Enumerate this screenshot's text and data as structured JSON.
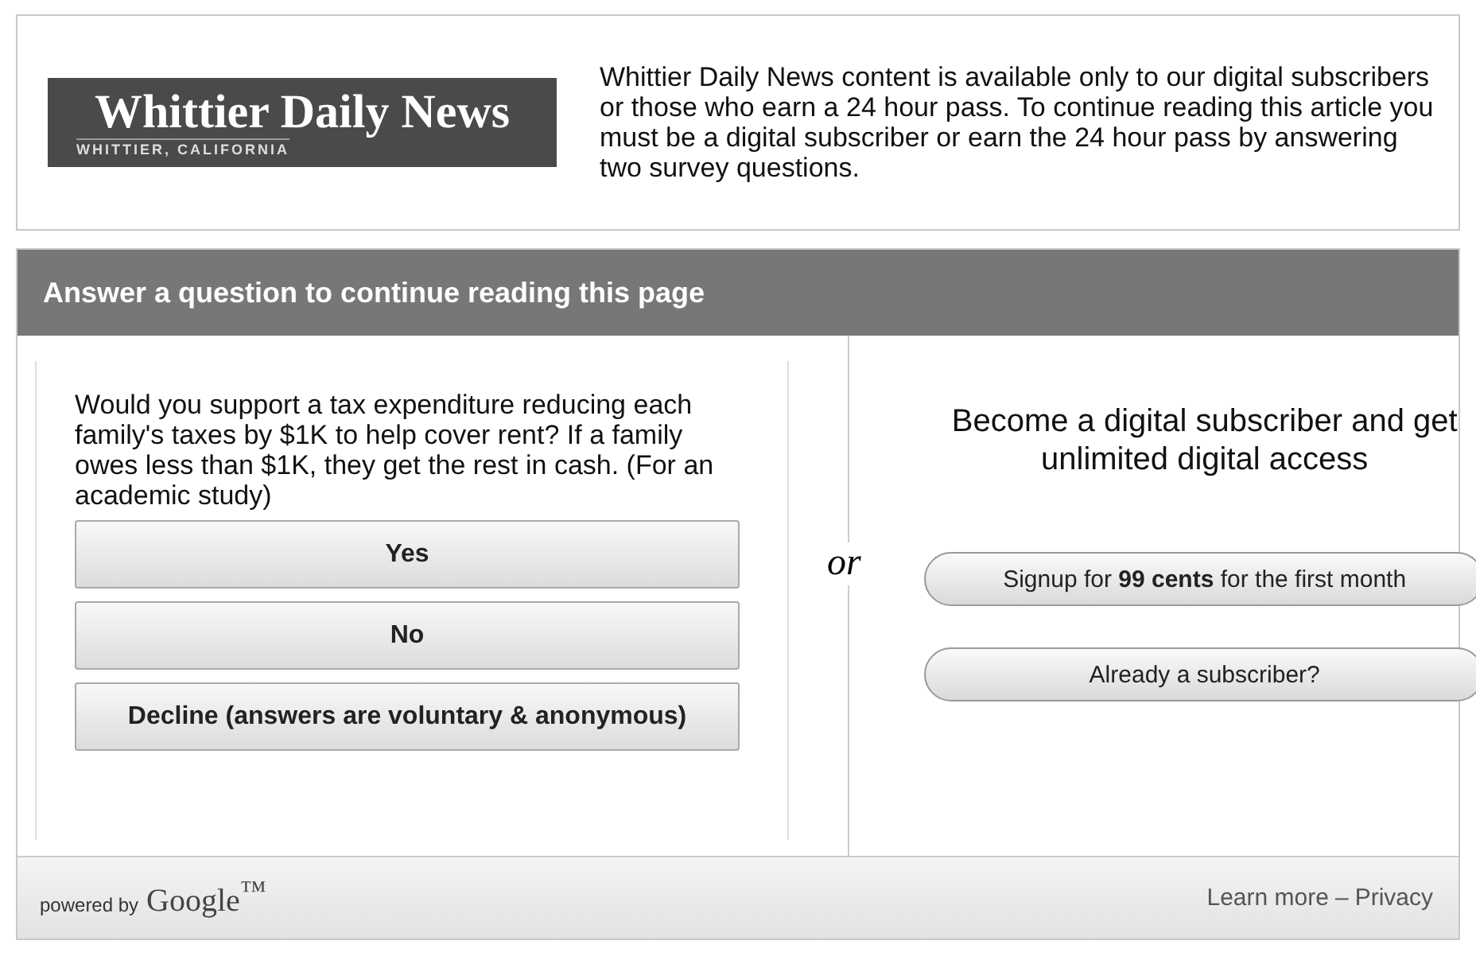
{
  "logo": {
    "title": "Whittier Daily News",
    "subtitle": "WHITTIER, CALIFORNIA"
  },
  "notice": "Whittier Daily News content is available only to our digital subscribers or those who earn a 24 hour pass. To continue reading this article you must be a digital subscriber or earn the 24 hour pass by answering two survey questions.",
  "header": "Answer a question to continue reading this page",
  "question": "Would you support a tax expenditure reducing each family's taxes by $1K to help cover rent? If a family owes less than $1K, they get the rest in cash. (For an academic study)",
  "answers": [
    "Yes",
    "No",
    "Decline (answers are voluntary & anonymous)"
  ],
  "separator": "or",
  "offer": "Become a digital subscriber and get unlimited digital access",
  "subscribe_buttons": [
    "Signup for **99 cents** for the first month",
    "Already a subscriber?"
  ],
  "footer": {
    "powered_by": "powered by",
    "brand": "Google$^{™}$",
    "links": [
      "Learn more",
      "Privacy"
    ],
    "link_separator": "–"
  }
}
